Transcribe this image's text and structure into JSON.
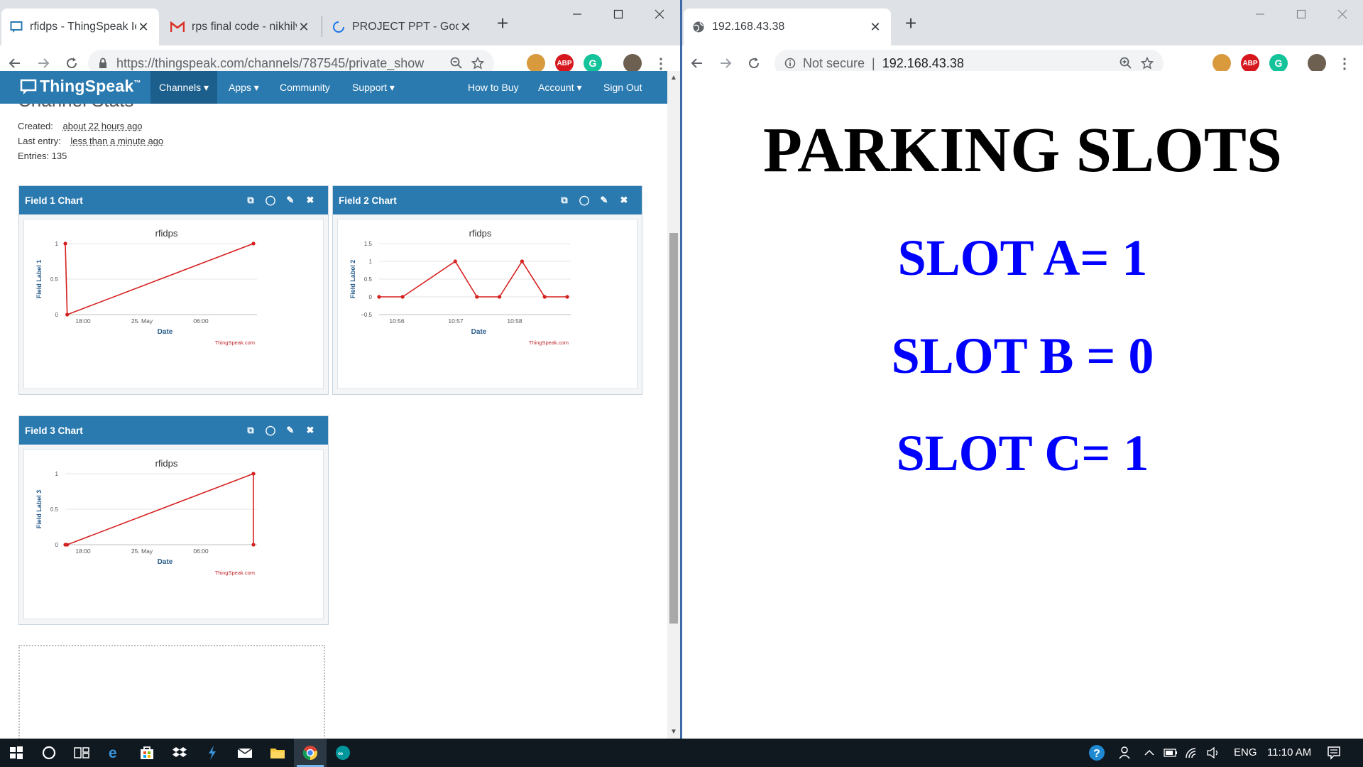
{
  "left_browser": {
    "tabs": [
      {
        "title": "rfidps - ThingSpeak Io"
      },
      {
        "title": "rps final code - nikhilv"
      },
      {
        "title": "PROJECT PPT - Googl"
      }
    ],
    "url": "https://thingspeak.com/channels/787545/private_show"
  },
  "right_browser": {
    "tabs": [
      {
        "title": "192.168.43.38"
      }
    ],
    "security_label": "Not secure",
    "url": "192.168.43.38"
  },
  "thingspeak": {
    "logo": "ThingSpeak",
    "tm": "™",
    "nav": {
      "channels": "Channels ▾",
      "apps": "Apps ▾",
      "community": "Community",
      "support": "Support ▾",
      "how_to_buy": "How to Buy",
      "account": "Account ▾",
      "sign_out": "Sign Out"
    },
    "stats_heading": "Channel Stats",
    "created_label": "Created:",
    "created_value": "about 22 hours ago",
    "last_entry_label": "Last entry:",
    "last_entry_value": "less than a minute ago",
    "entries": "Entries: 135",
    "panels": [
      {
        "title": "Field 1 Chart"
      },
      {
        "title": "Field 2 Chart"
      },
      {
        "title": "Field 3 Chart"
      }
    ]
  },
  "parking": {
    "title": "PARKING SLOTS",
    "slot_a": "SLOT A= 1",
    "slot_b": "SLOT B = 0",
    "slot_c": "SLOT C= 1"
  },
  "taskbar": {
    "lang": "ENG",
    "time": "11:10 AM"
  },
  "chart_data": [
    {
      "type": "line",
      "title": "rfidps",
      "xlabel": "Date",
      "ylabel": "Field Label 1",
      "credit": "ThingSpeak.com",
      "x_ticks": [
        "18:00",
        "25. May",
        "06:00"
      ],
      "y_ticks": [
        "0",
        "0.5",
        "1"
      ],
      "ylim": [
        0,
        1
      ],
      "x_fractions": [
        0.0,
        0.01,
        1.0
      ],
      "values": [
        1,
        0,
        1
      ],
      "color": "#d62020"
    },
    {
      "type": "line",
      "title": "rfidps",
      "xlabel": "Date",
      "ylabel": "Field Label 2",
      "credit": "ThingSpeak.com",
      "x_ticks": [
        "10:56",
        "10:57",
        "10:58"
      ],
      "y_ticks": [
        "−0.5",
        "0",
        "0.5",
        "1",
        "1.5"
      ],
      "ylim": [
        -0.5,
        1.5
      ],
      "x_fractions": [
        0.0,
        0.125,
        0.405,
        0.52,
        0.64,
        0.76,
        0.88,
        1.0
      ],
      "values": [
        0,
        0,
        1,
        0,
        0,
        1,
        0,
        0
      ],
      "color": "#d62020"
    },
    {
      "type": "line",
      "title": "rfidps",
      "xlabel": "Date",
      "ylabel": "Field Label 3",
      "credit": "ThingSpeak.com",
      "x_ticks": [
        "18:00",
        "25. May",
        "06:00"
      ],
      "y_ticks": [
        "0",
        "0.5",
        "1"
      ],
      "ylim": [
        0,
        1
      ],
      "x_fractions": [
        0.0,
        0.01,
        1.0,
        1.0
      ],
      "values": [
        0,
        0,
        1,
        0
      ],
      "color": "#d62020"
    }
  ]
}
